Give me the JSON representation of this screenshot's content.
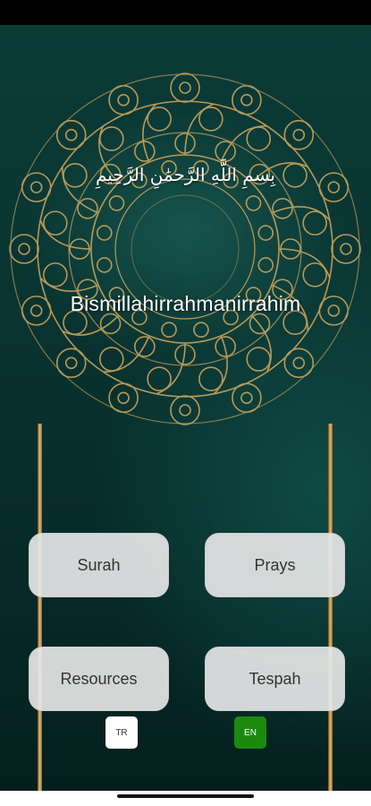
{
  "header": {
    "arabic_text": "بِسمِ اللَّهِ الرَّحمَٰنِ الرَّحِيمِ",
    "title": "Bismillahirrahmanirrahim"
  },
  "menu": {
    "surah_label": "Surah",
    "prays_label": "Prays",
    "resources_label": "Resources",
    "tespah_label": "Tespah"
  },
  "language": {
    "tr_label": "TR",
    "en_label": "EN",
    "selected": "EN"
  },
  "colors": {
    "background": "#0a3b37",
    "ornament_gold": "#c9a45c",
    "button_bg": "#e6e6e6",
    "selected_language": "#1a8a0f"
  }
}
